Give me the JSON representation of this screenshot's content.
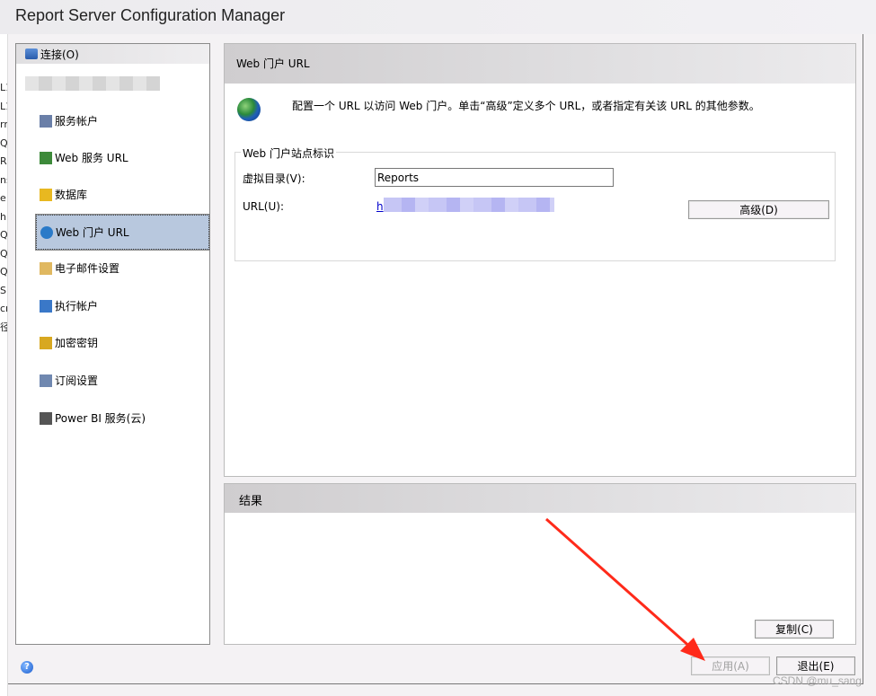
{
  "window": {
    "title": "Report Server Configuration Manager"
  },
  "left_strip": [
    "L1",
    "L1",
    "rr",
    "Q",
    "R",
    "ns",
    "e",
    "h",
    "Q",
    "Q",
    "Q",
    "S",
    "cr",
    "径"
  ],
  "nav": {
    "connect_label": "连接(O)",
    "items": [
      {
        "label": "服务帐户",
        "icon": "service-account-icon"
      },
      {
        "label": "Web 服务 URL",
        "icon": "web-service-icon"
      },
      {
        "label": "数据库",
        "icon": "database-icon"
      },
      {
        "label": "Web 门户 URL",
        "icon": "globe-icon",
        "selected": true
      },
      {
        "label": "电子邮件设置",
        "icon": "email-icon"
      },
      {
        "label": "执行帐户",
        "icon": "execution-account-icon"
      },
      {
        "label": "加密密钥",
        "icon": "keys-icon"
      },
      {
        "label": "订阅设置",
        "icon": "subscription-icon"
      },
      {
        "label": "Power BI 服务(云)",
        "icon": "power-bi-icon"
      }
    ]
  },
  "main": {
    "title": "Web 门户 URL",
    "description": "配置一个 URL 以访问 Web 门户。单击“高级”定义多个 URL，或者指定有关该 URL 的其他参数。",
    "group_label": "Web 门户站点标识",
    "virtual_dir_label": "虚拟目录(V):",
    "virtual_dir_value": "Reports",
    "url_label": "URL(U):",
    "url_value": "h",
    "advanced_button": "高级(D)"
  },
  "results": {
    "title": "结果",
    "copy_button": "复制(C)"
  },
  "footer": {
    "apply_button": "应用(A)",
    "apply_enabled": false,
    "exit_button": "退出(E)"
  },
  "watermark": "CSDN @mu_sang",
  "colors": {
    "selected": "#b8c8de",
    "arrow": "#ff2a1a"
  }
}
